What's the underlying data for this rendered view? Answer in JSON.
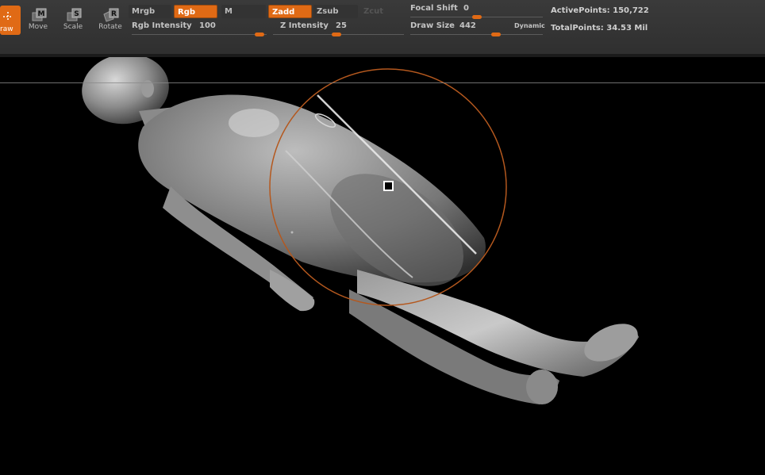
{
  "tools": {
    "draw": "raw",
    "move": "Move",
    "scale": "Scale",
    "rotate": "Rotate",
    "move_key": "M",
    "scale_key": "S",
    "rotate_key": "R"
  },
  "modes": {
    "mrgb": "Mrgb",
    "rgb": "Rgb",
    "m": "M",
    "zadd": "Zadd",
    "zsub": "Zsub",
    "zcut": "Zcut"
  },
  "sliders": {
    "rgb_intensity_label": "Rgb Intensity",
    "rgb_intensity_value": "100",
    "z_intensity_label": "Z Intensity",
    "z_intensity_value": "25",
    "focal_shift_label": "Focal Shift",
    "focal_shift_value": "0",
    "draw_size_label": "Draw Size",
    "draw_size_value": "442",
    "dynamic_label": "Dynamic"
  },
  "stats": {
    "active_points_label": "ActivePoints:",
    "active_points_value": "150,722",
    "total_points_label": "TotalPoints:",
    "total_points_value": "34.53 Mil"
  },
  "colors": {
    "accent": "#e06a15",
    "brush_ring": "#b4581e",
    "panel": "#353535"
  },
  "icons": [
    "crosshair-icon",
    "move-icon",
    "scale-icon",
    "rotate-icon"
  ]
}
